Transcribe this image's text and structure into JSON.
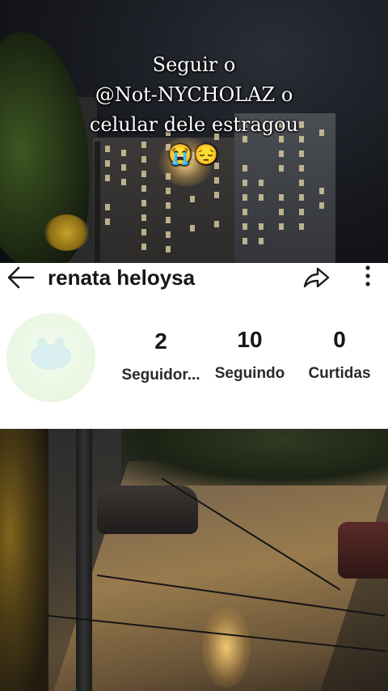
{
  "caption": {
    "line1": "Seguir o",
    "line2": "@Not-NYCHOLAZ o",
    "line3": "celular dele estragou",
    "emojis": "😭😔"
  },
  "profile": {
    "username": "renata heloysa",
    "stats": [
      {
        "value": "2",
        "label": "Seguidor..."
      },
      {
        "value": "10",
        "label": "Seguindo"
      },
      {
        "value": "0",
        "label": "Curtidas"
      }
    ]
  },
  "icons": {
    "back": "arrow-left-icon",
    "share": "share-arrow-icon",
    "more": "more-vertical-icon"
  },
  "colors": {
    "panel_bg": "#ffffff",
    "text": "#161616",
    "caption_text": "#ffffff"
  }
}
